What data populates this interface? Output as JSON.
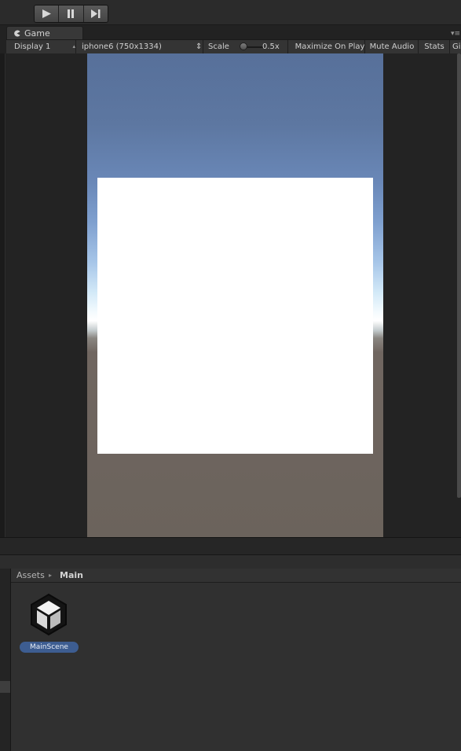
{
  "toolbar": {
    "play_icon": "play-icon",
    "pause_icon": "pause-icon",
    "step_icon": "step-icon"
  },
  "game_tab": {
    "label": "Game",
    "icon": "pacman-icon"
  },
  "game_bar": {
    "display": "Display 1",
    "resolution": "iphone6 (750x1334)",
    "scale_label": "Scale",
    "scale_value": "0.5x",
    "maximize_on_play": "Maximize On Play",
    "mute_audio": "Mute Audio",
    "stats": "Stats",
    "gizmos": "Gizmos"
  },
  "project": {
    "breadcrumb_root": "Assets",
    "breadcrumb_current": "Main",
    "asset_name": "MainScene",
    "asset_icon": "unity-logo-icon"
  },
  "colors": {
    "sky_top": "#57709a",
    "horizon": "#ffffff",
    "ground": "#6b635c",
    "selection": "#3d5d91"
  }
}
